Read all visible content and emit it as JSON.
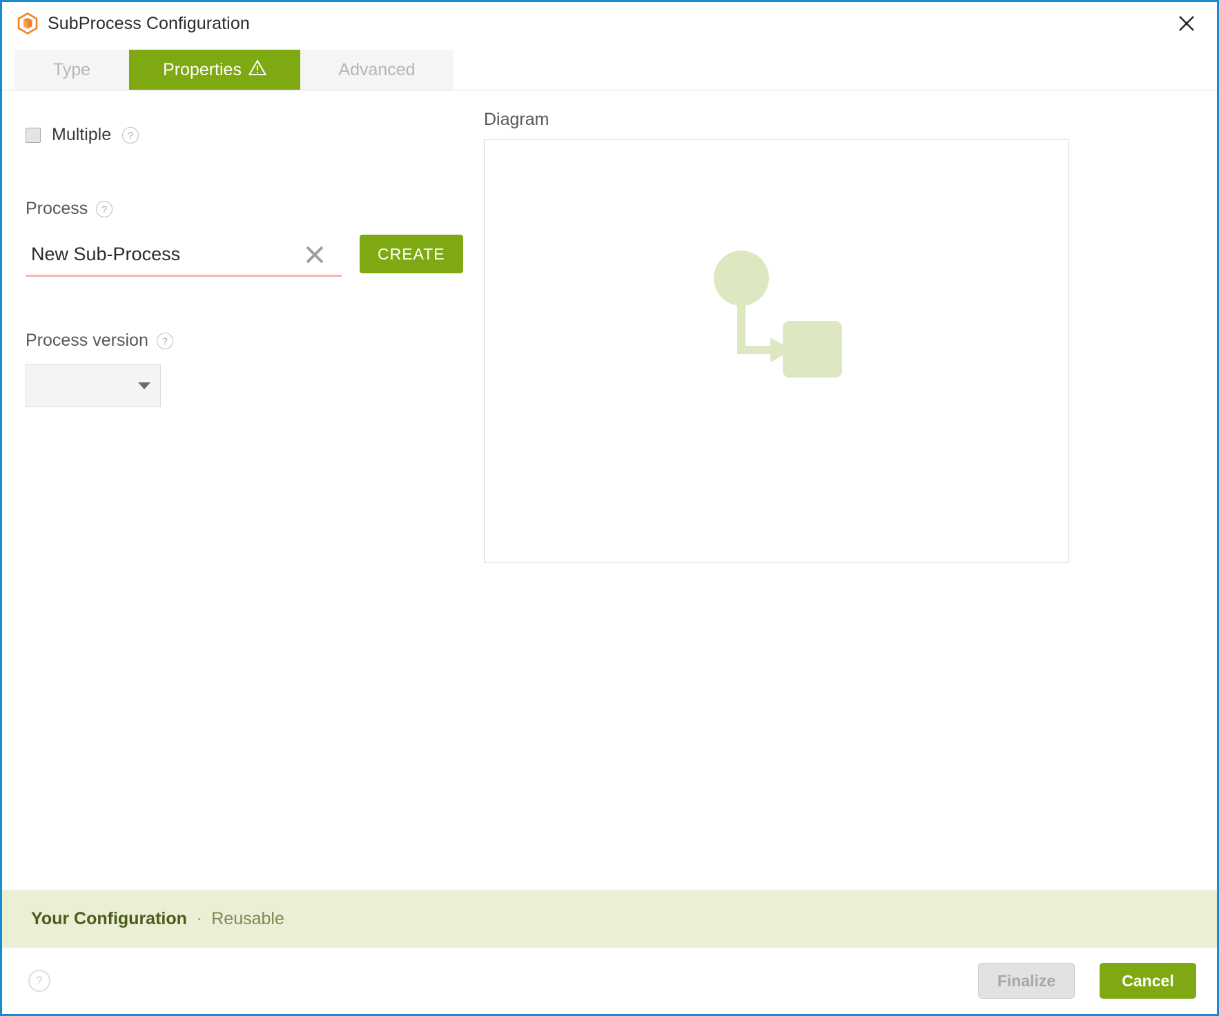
{
  "window": {
    "title": "SubProcess Configuration",
    "icon": "hexagon-cube-icon",
    "close_icon": "close-icon"
  },
  "tabs": [
    {
      "label": "Type",
      "active": false,
      "warning": false
    },
    {
      "label": "Properties",
      "active": true,
      "warning": true
    },
    {
      "label": "Advanced",
      "active": false,
      "warning": false
    }
  ],
  "form": {
    "multiple": {
      "label": "Multiple",
      "checked": false,
      "help_icon": "help-circle-icon"
    },
    "process": {
      "label": "Process",
      "help_icon": "help-circle-icon",
      "value": "New Sub-Process",
      "clear_icon": "clear-x-icon",
      "invalid": true,
      "create_label": "CREATE"
    },
    "process_version": {
      "label": "Process version",
      "help_icon": "help-circle-icon",
      "value": "",
      "options": [],
      "caret_icon": "chevron-down-icon"
    }
  },
  "diagram": {
    "label": "Diagram",
    "shapes": [
      {
        "type": "start-event-circle",
        "color": "#dde7c0"
      },
      {
        "type": "sequence-flow-arrow",
        "color": "#dde7c0"
      },
      {
        "type": "task-rounded-rect",
        "color": "#dde7c0"
      }
    ]
  },
  "config_banner": {
    "title": "Your Configuration",
    "separator": "·",
    "subtitle": "Reusable"
  },
  "footer": {
    "help_icon": "help-circle-icon",
    "finalize_label": "Finalize",
    "finalize_disabled": true,
    "cancel_label": "Cancel"
  },
  "colors": {
    "accent_green": "#7fa913",
    "banner_green": "#eaefd6",
    "diagram_green": "#dde7c0",
    "brand_orange": "#ef8322",
    "window_border_blue": "#1b8bd0",
    "error_underline": "#f2b5b5"
  }
}
